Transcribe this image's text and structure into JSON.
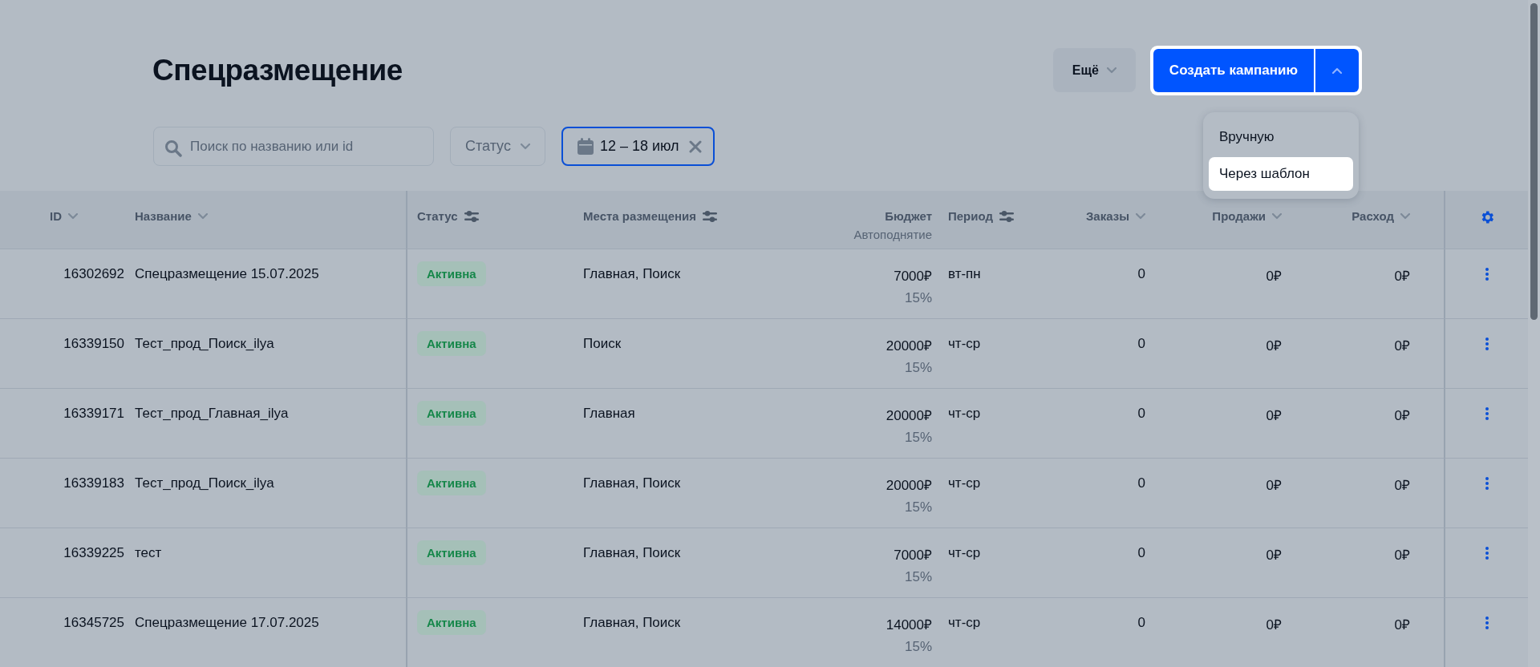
{
  "page_title": "Спецразмещение",
  "more_button": {
    "label": "Ещё"
  },
  "create_button": {
    "label": "Создать кампанию",
    "expanded": true
  },
  "create_menu": [
    {
      "label": "Вручную",
      "selected": false
    },
    {
      "label": "Через шаблон",
      "selected": true
    }
  ],
  "search": {
    "placeholder": "Поиск по названию или id"
  },
  "status_filter": {
    "label": "Статус"
  },
  "date_filter": {
    "label": "12 – 18 июл",
    "active": true
  },
  "table": {
    "columns": [
      {
        "label": "ID",
        "kind": "sortable"
      },
      {
        "label": "Название",
        "kind": "sortable"
      },
      {
        "label": "Статус",
        "kind": "filterable"
      },
      {
        "label": "Места размещения",
        "kind": "filterable"
      },
      {
        "label": "Бюджет",
        "sub": "Автоподнятие"
      },
      {
        "label": "Период",
        "kind": "filterable"
      },
      {
        "label": "Заказы",
        "kind": "sortable"
      },
      {
        "label": "Продажи",
        "kind": "sortable"
      },
      {
        "label": "Расход",
        "kind": "sortable"
      }
    ],
    "rows": [
      {
        "id": "16302692",
        "name": "Спецразмещение 15.07.2025",
        "status": "Активна",
        "places": "Главная, Поиск",
        "budget": "7000₽",
        "autoraise": "15%",
        "period": "вт-пн",
        "orders": "0",
        "sales": "0₽",
        "expense": "0₽"
      },
      {
        "id": "16339150",
        "name": "Тест_прод_Поиск_ilya",
        "status": "Активна",
        "places": "Поиск",
        "budget": "20000₽",
        "autoraise": "15%",
        "period": "чт-ср",
        "orders": "0",
        "sales": "0₽",
        "expense": "0₽"
      },
      {
        "id": "16339171",
        "name": "Тест_прод_Главная_ilya",
        "status": "Активна",
        "places": "Главная",
        "budget": "20000₽",
        "autoraise": "15%",
        "period": "чт-ср",
        "orders": "0",
        "sales": "0₽",
        "expense": "0₽"
      },
      {
        "id": "16339183",
        "name": "Тест_прод_Поиск_ilya",
        "status": "Активна",
        "places": "Главная, Поиск",
        "budget": "20000₽",
        "autoraise": "15%",
        "period": "чт-ср",
        "orders": "0",
        "sales": "0₽",
        "expense": "0₽"
      },
      {
        "id": "16339225",
        "name": "тест",
        "status": "Активна",
        "places": "Главная, Поиск",
        "budget": "7000₽",
        "autoraise": "15%",
        "period": "чт-ср",
        "orders": "0",
        "sales": "0₽",
        "expense": "0₽"
      },
      {
        "id": "16345725",
        "name": "Спецразмещение 17.07.2025",
        "status": "Активна",
        "places": "Главная, Поиск",
        "budget": "14000₽",
        "autoraise": "15%",
        "period": "чт-ср",
        "orders": "0",
        "sales": "0₽",
        "expense": "0₽"
      }
    ]
  }
}
